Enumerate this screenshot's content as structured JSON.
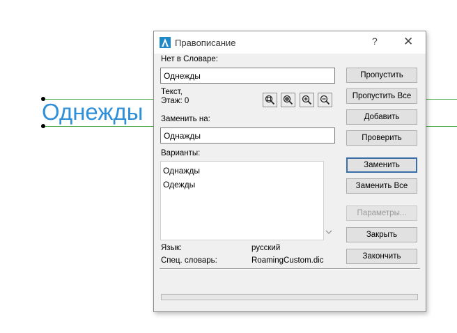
{
  "canvas": {
    "word": "Однежды"
  },
  "dialog": {
    "title": "Правописание",
    "help": "?",
    "close": "✕",
    "not_in_dict_label": "Нет в Словаре:",
    "not_in_dict_value": "Однежды",
    "context_line1": "Текст,",
    "context_line2": "Этаж: 0",
    "replace_with_label": "Заменить на:",
    "replace_with_value": "Однажды",
    "variants_label": "Варианты:",
    "variants": [
      "Однажды",
      "Одежды"
    ],
    "language_label": "Язык:",
    "language_value": "русский",
    "custom_dict_label": "Спец. словарь:",
    "custom_dict_value": "RoamingCustom.dic",
    "buttons": {
      "skip": "Пропустить",
      "skip_all": "Пропустить Все",
      "add": "Добавить",
      "check": "Проверить",
      "replace": "Заменить",
      "replace_all": "Заменить Все",
      "options": "Параметры...",
      "close": "Закрыть",
      "finish": "Закончить"
    }
  },
  "colors": {
    "canvas_text": "#2f8fd8",
    "guide_line": "#4caf50",
    "primary_border": "#3a6ea8"
  }
}
